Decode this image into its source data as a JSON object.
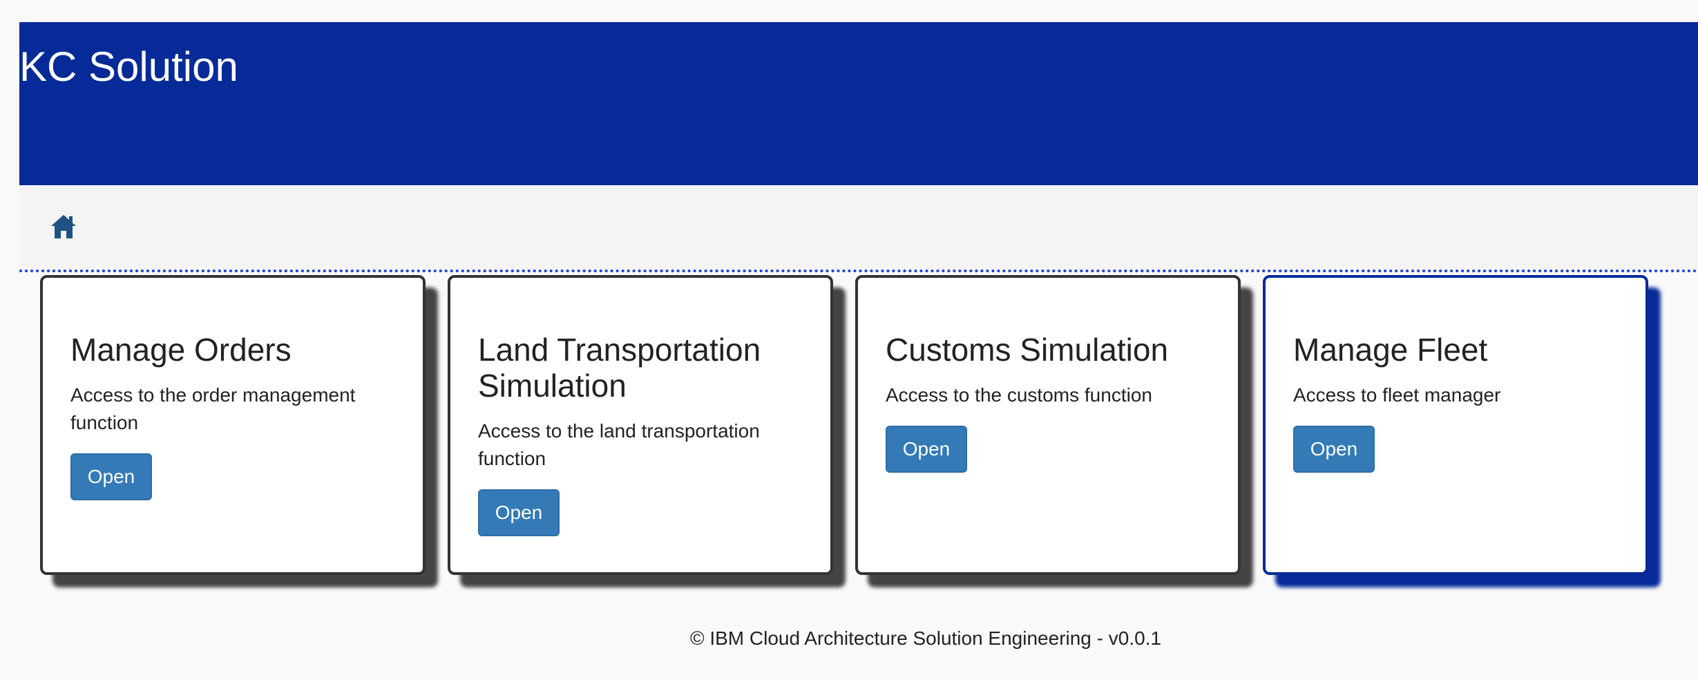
{
  "header": {
    "title": "KC Solution"
  },
  "nav": {
    "home_icon": "home-icon",
    "icon_color": "#1f5285"
  },
  "cards": [
    {
      "title": "Manage Orders",
      "description": "Access to the order management function",
      "button_label": "Open"
    },
    {
      "title": "Land Transportation Simulation",
      "description": "Access to the land transportation function",
      "button_label": "Open"
    },
    {
      "title": "Customs Simulation",
      "description": "Access to the customs function",
      "button_label": "Open"
    },
    {
      "title": "Manage Fleet",
      "description": "Access to fleet manager",
      "button_label": "Open"
    }
  ],
  "footer": {
    "text": "© IBM Cloud Architecture Solution Engineering - v0.0.1"
  },
  "colors": {
    "header_bg": "#062a98",
    "button_bg": "#337ab7",
    "active_accent": "#062a98"
  }
}
